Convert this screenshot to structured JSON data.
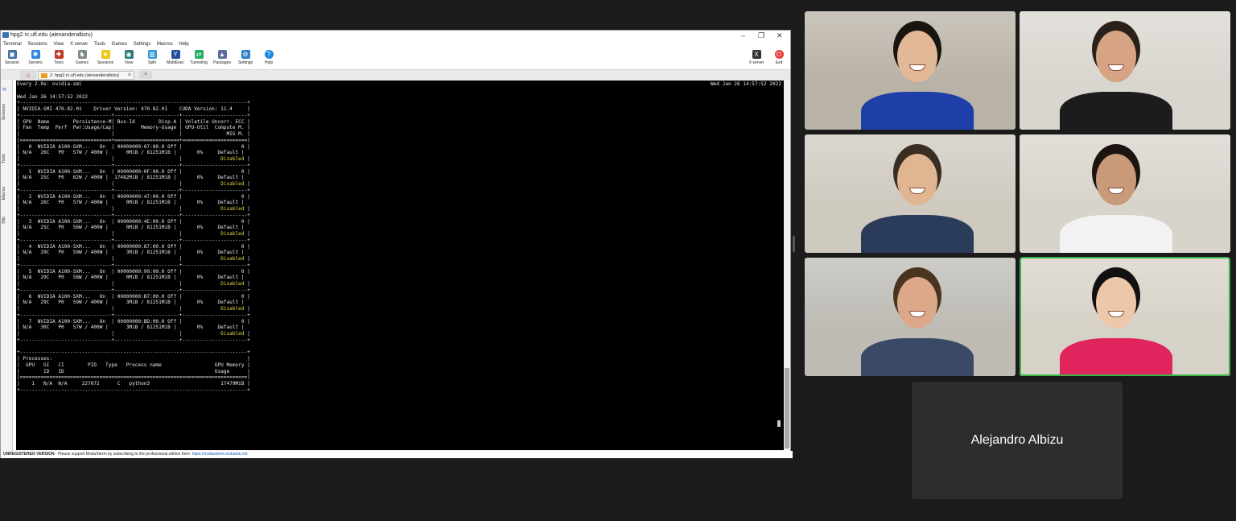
{
  "window": {
    "title": "hpg2.rc.ufl.edu (alexanderalbizu)",
    "controls": [
      "–",
      "❐",
      "✕"
    ]
  },
  "menu": [
    "Terminal",
    "Sessions",
    "View",
    "X server",
    "Tools",
    "Games",
    "Settings",
    "Macros",
    "Help"
  ],
  "toolbar": {
    "left": [
      {
        "label": "Session",
        "icon": "session-icon",
        "color": "#3a6ea5"
      },
      {
        "label": "Servers",
        "icon": "servers-icon",
        "color": "#2e86de"
      },
      {
        "label": "Tools",
        "icon": "tools-icon",
        "color": "#c0392b"
      },
      {
        "label": "Games",
        "icon": "games-icon",
        "color": "#7f8c8d"
      },
      {
        "label": "Sessions",
        "icon": "star-icon",
        "color": "#f1c40f"
      },
      {
        "label": "View",
        "icon": "view-icon",
        "color": "#2c7a7b"
      },
      {
        "label": "Split",
        "icon": "split-icon",
        "color": "#3498db"
      },
      {
        "label": "MultiExec",
        "icon": "multiexec-icon",
        "color": "#1f4e9c"
      },
      {
        "label": "Tunneling",
        "icon": "tunneling-icon",
        "color": "#27ae60"
      },
      {
        "label": "Packages",
        "icon": "packages-icon",
        "color": "#5d6d9e"
      },
      {
        "label": "Settings",
        "icon": "settings-icon",
        "color": "#2f80c8"
      },
      {
        "label": "Help",
        "icon": "help-icon",
        "color": "#1e88e5"
      }
    ],
    "right": [
      {
        "label": "X server",
        "icon": "xserver-icon",
        "color": "#333333"
      },
      {
        "label": "Exit",
        "icon": "power-icon",
        "color": "#e53935"
      }
    ]
  },
  "tabs": {
    "active_label": "2. hpg2.rc.ufl.edu (alexanderalbizu)",
    "close": "×"
  },
  "sidebar": [
    "Sessions",
    "Tools",
    "Macros",
    "Sftp"
  ],
  "terminal": {
    "header_left": "Every 2.0s: nvidia-smi",
    "header_right": "Wed Jan 26 14:57:52 2022",
    "date_line": "Wed Jan 26 14:57:52 2022",
    "summary": {
      "smi_version": "470.82.01",
      "driver_version": "470.82.01",
      "cuda_version": "11.4"
    },
    "column_headers": {
      "line1": [
        "GPU",
        "Name",
        "Persistence-M",
        "Bus-Id",
        "Disp.A",
        "Volatile Uncorr. ECC"
      ],
      "line2": [
        "Fan",
        "Temp",
        "Perf",
        "Pwr:Usage/Cap",
        "Memory-Usage",
        "GPU-Util",
        "Compute M."
      ],
      "line3": [
        "MIG M."
      ]
    },
    "gpus": [
      {
        "id": "0",
        "name": "NVIDIA A100-SXM...",
        "persistence": "On",
        "bus_id": "00000000:07:00.0",
        "disp": "Off",
        "ecc": "0",
        "fan": "N/A",
        "temp": "26C",
        "perf": "P0",
        "power": "57W / 400W",
        "memory": "0MiB / 81251MiB",
        "util": "0%",
        "compute": "Default",
        "mig": "Disabled"
      },
      {
        "id": "1",
        "name": "NVIDIA A100-SXM...",
        "persistence": "On",
        "bus_id": "00000000:0F:00.0",
        "disp": "Off",
        "ecc": "0",
        "fan": "N/A",
        "temp": "25C",
        "perf": "P0",
        "power": "62W / 400W",
        "memory": "17482MiB / 81251MiB",
        "util": "0%",
        "compute": "Default",
        "mig": "Disabled"
      },
      {
        "id": "2",
        "name": "NVIDIA A100-SXM...",
        "persistence": "On",
        "bus_id": "00000000:47:00.0",
        "disp": "Off",
        "ecc": "0",
        "fan": "N/A",
        "temp": "26C",
        "perf": "P0",
        "power": "57W / 400W",
        "memory": "0MiB / 81251MiB",
        "util": "0%",
        "compute": "Default",
        "mig": "Disabled"
      },
      {
        "id": "3",
        "name": "NVIDIA A100-SXM...",
        "persistence": "On",
        "bus_id": "00000000:4E:00.0",
        "disp": "Off",
        "ecc": "0",
        "fan": "N/A",
        "temp": "25C",
        "perf": "P0",
        "power": "56W / 400W",
        "memory": "0MiB / 81251MiB",
        "util": "0%",
        "compute": "Default",
        "mig": "Disabled"
      },
      {
        "id": "4",
        "name": "NVIDIA A100-SXM...",
        "persistence": "On",
        "bus_id": "00000000:87:00.0",
        "disp": "Off",
        "ecc": "0",
        "fan": "N/A",
        "temp": "29C",
        "perf": "P0",
        "power": "59W / 400W",
        "memory": "3MiB / 81251MiB",
        "util": "0%",
        "compute": "Default",
        "mig": "Disabled"
      },
      {
        "id": "5",
        "name": "NVIDIA A100-SXM...",
        "persistence": "On",
        "bus_id": "00000000:90:00.0",
        "disp": "Off",
        "ecc": "0",
        "fan": "N/A",
        "temp": "29C",
        "perf": "P0",
        "power": "58W / 400W",
        "memory": "0MiB / 81251MiB",
        "util": "0%",
        "compute": "Default",
        "mig": "Disabled"
      },
      {
        "id": "6",
        "name": "NVIDIA A100-SXM...",
        "persistence": "On",
        "bus_id": "00000000:B7:00.0",
        "disp": "Off",
        "ecc": "0",
        "fan": "N/A",
        "temp": "29C",
        "perf": "P0",
        "power": "59W / 400W",
        "memory": "3MiB / 81251MiB",
        "util": "0%",
        "compute": "Default",
        "mig": "Disabled"
      },
      {
        "id": "7",
        "name": "NVIDIA A100-SXM...",
        "persistence": "On",
        "bus_id": "00000000:BD:00.0",
        "disp": "Off",
        "ecc": "0",
        "fan": "N/A",
        "temp": "30C",
        "perf": "P0",
        "power": "57W / 400W",
        "memory": "3MiB / 81251MiB",
        "util": "0%",
        "compute": "Default",
        "mig": "Disabled"
      }
    ],
    "processes": {
      "title": "Processes:",
      "headers": [
        "GPU",
        "GI",
        "CI",
        "PID",
        "Type",
        "Process name",
        "GPU Memory"
      ],
      "headers2": [
        "ID",
        "ID",
        "Usage"
      ],
      "rows": [
        {
          "gpu": "1",
          "gi": "N/A",
          "ci": "N/A",
          "pid": "227072",
          "type": "C",
          "name": "python3",
          "mem": "17479MiB"
        }
      ]
    }
  },
  "status_bar": {
    "bold": "UNREGISTERED VERSION",
    "text": "  -  Please support MobaXterm by subscribing to the professional edition here:",
    "link": "https://mobaxterm.mobatek.net"
  },
  "participants": {
    "named_tile": "Alejandro Albizu",
    "video_tiles": [
      {
        "bg": "#b9b2a6",
        "skin": "#e2b896",
        "shirt": "#1f3fa8",
        "hair": "#1a1410"
      },
      {
        "bg": "#d9d6cf",
        "skin": "#d6a484",
        "shirt": "#1c1c1c",
        "hair": "#2b211a"
      },
      {
        "bg": "#cfcac0",
        "skin": "#e0b692",
        "shirt": "#2b3b5a",
        "hair": "#3a2e22"
      },
      {
        "bg": "#d8d4cc",
        "skin": "#c99a7a",
        "shirt": "#f2f2f2",
        "hair": "#1b1410"
      },
      {
        "bg": "#bdbbb4",
        "skin": "#dba98a",
        "shirt": "#3a4a66",
        "hair": "#4a3420"
      },
      {
        "bg": "#d7d2c8",
        "skin": "#edc8a8",
        "shirt": "#e0245e",
        "hair": "#111111"
      }
    ],
    "active_speaker_color": "#3bb54a"
  }
}
